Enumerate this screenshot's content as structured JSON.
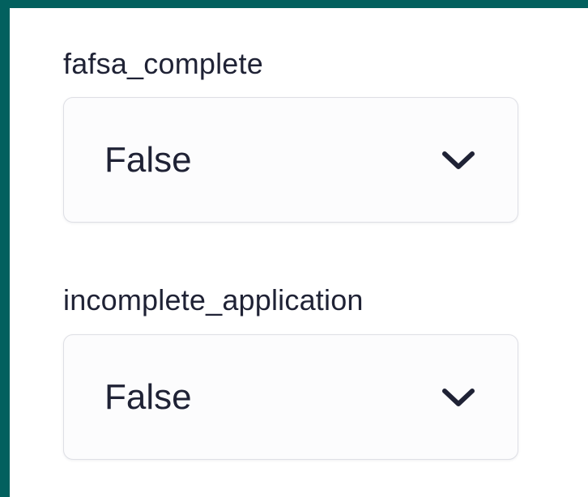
{
  "fields": [
    {
      "label": "fafsa_complete",
      "value": "False"
    },
    {
      "label": "incomplete_application",
      "value": "False"
    }
  ],
  "icons": {
    "dropdown": "chevron-down-icon"
  },
  "colors": {
    "frame": "#02605e",
    "panel": "#ffffff",
    "text": "#1f2235",
    "border": "#dedfe5"
  }
}
